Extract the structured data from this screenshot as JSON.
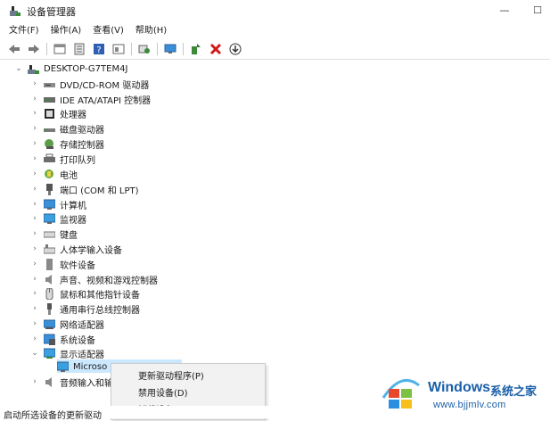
{
  "window": {
    "title": "设备管理器",
    "minimize_glyph": "—",
    "maximize_glyph": "☐"
  },
  "menu": {
    "items": [
      "文件(F)",
      "操作(A)",
      "查看(V)",
      "帮助(H)"
    ]
  },
  "toolbar": {
    "icons": [
      "back-icon",
      "forward-icon",
      "properties-icon",
      "update-icon",
      "help-icon",
      "show-hidden-icon",
      "scan-icon",
      "monitor-icon",
      "add-driver-icon",
      "uninstall-icon",
      "download-icon"
    ]
  },
  "tree": {
    "root": "DESKTOP-G7TEM4J",
    "categories": [
      "DVD/CD-ROM 驱动器",
      "IDE ATA/ATAPI 控制器",
      "处理器",
      "磁盘驱动器",
      "存储控制器",
      "打印队列",
      "电池",
      "端口 (COM 和 LPT)",
      "计算机",
      "监视器",
      "键盘",
      "人体学输入设备",
      "软件设备",
      "声音、视频和游戏控制器",
      "鼠标和其他指针设备",
      "通用串行总线控制器",
      "网络适配器",
      "系统设备",
      "显示适配器"
    ],
    "display_child": "Microso",
    "after": "音频输入和输"
  },
  "context_menu": {
    "items": [
      "更新驱动程序(P)",
      "禁用设备(D)",
      "卸载设备(U)"
    ]
  },
  "status": {
    "text": "启动所选设备的更新驱动"
  },
  "watermark": {
    "brand": "Windows",
    "brand_cn": "系统之家",
    "url": "www.bjjmlv.com"
  },
  "colors": {
    "selection": "#cce8ff",
    "watermark": "#1a5fa8",
    "uninstall_red": "#d11a1a"
  }
}
